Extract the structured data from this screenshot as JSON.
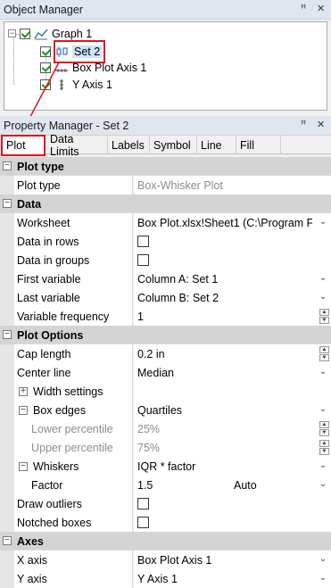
{
  "object_manager": {
    "title": "Object Manager",
    "pin_glyph": "ꟸ",
    "close_glyph": "✕",
    "tree": [
      {
        "label": "Graph 1",
        "expander": "−"
      },
      {
        "label": "Set 2"
      },
      {
        "label": "Box Plot Axis 1"
      },
      {
        "label": "Y Axis 1"
      }
    ]
  },
  "property_manager": {
    "title": "Property Manager - Set 2",
    "tabs": [
      {
        "label": "Plot"
      },
      {
        "label": "Data Limits"
      },
      {
        "label": "Labels"
      },
      {
        "label": "Symbol"
      },
      {
        "label": "Line"
      },
      {
        "label": "Fill"
      }
    ],
    "sections": {
      "plot_type": {
        "label": "Plot type",
        "collapse": "−",
        "rows": [
          {
            "label": "Plot type",
            "value": "Box-Whisker Plot"
          }
        ]
      },
      "data": {
        "label": "Data",
        "collapse": "−",
        "rows": [
          {
            "label": "Worksheet",
            "value": "Box Plot.xlsx!Sheet1 (C:\\Program Fil..."
          },
          {
            "label": "Data in rows",
            "checked": false
          },
          {
            "label": "Data in groups",
            "checked": false
          },
          {
            "label": "First variable",
            "value": "Column A: Set 1"
          },
          {
            "label": "Last variable",
            "value": "Column B: Set 2"
          },
          {
            "label": "Variable frequency",
            "value": "1"
          }
        ]
      },
      "plot_options": {
        "label": "Plot Options",
        "collapse": "−",
        "rows": [
          {
            "label": "Cap length",
            "value": "0.2 in"
          },
          {
            "label": "Center line",
            "value": "Median"
          },
          {
            "label": "Width settings",
            "expander": "+",
            "value": ""
          },
          {
            "label": "Box edges",
            "expander": "−",
            "value": "Quartiles"
          },
          {
            "label": "Lower percentile",
            "value": "25%"
          },
          {
            "label": "Upper percentile",
            "value": "75%"
          },
          {
            "label": "Whiskers",
            "expander": "−",
            "value": "IQR * factor"
          },
          {
            "label": "Factor",
            "value": "1.5",
            "value2": "Auto"
          },
          {
            "label": "Draw outliers",
            "checked": false
          },
          {
            "label": "Notched boxes",
            "checked": false
          }
        ]
      },
      "axes": {
        "label": "Axes",
        "collapse": "−",
        "rows": [
          {
            "label": "X axis",
            "value": "Box Plot Axis 1"
          },
          {
            "label": "Y axis",
            "value": "Y Axis 1"
          }
        ]
      }
    }
  },
  "colors": {
    "highlight": "#e0141a",
    "category_bg": "#d4d4d4",
    "title_bg": "#dfe6ef"
  },
  "icons": {
    "dropdown": "chevron-down-icon",
    "spinner": "spinner-icon",
    "pin": "pin-icon",
    "close": "close-icon",
    "graph": "graph-icon",
    "boxplot": "boxplot-icon",
    "axis": "axis-icon"
  }
}
